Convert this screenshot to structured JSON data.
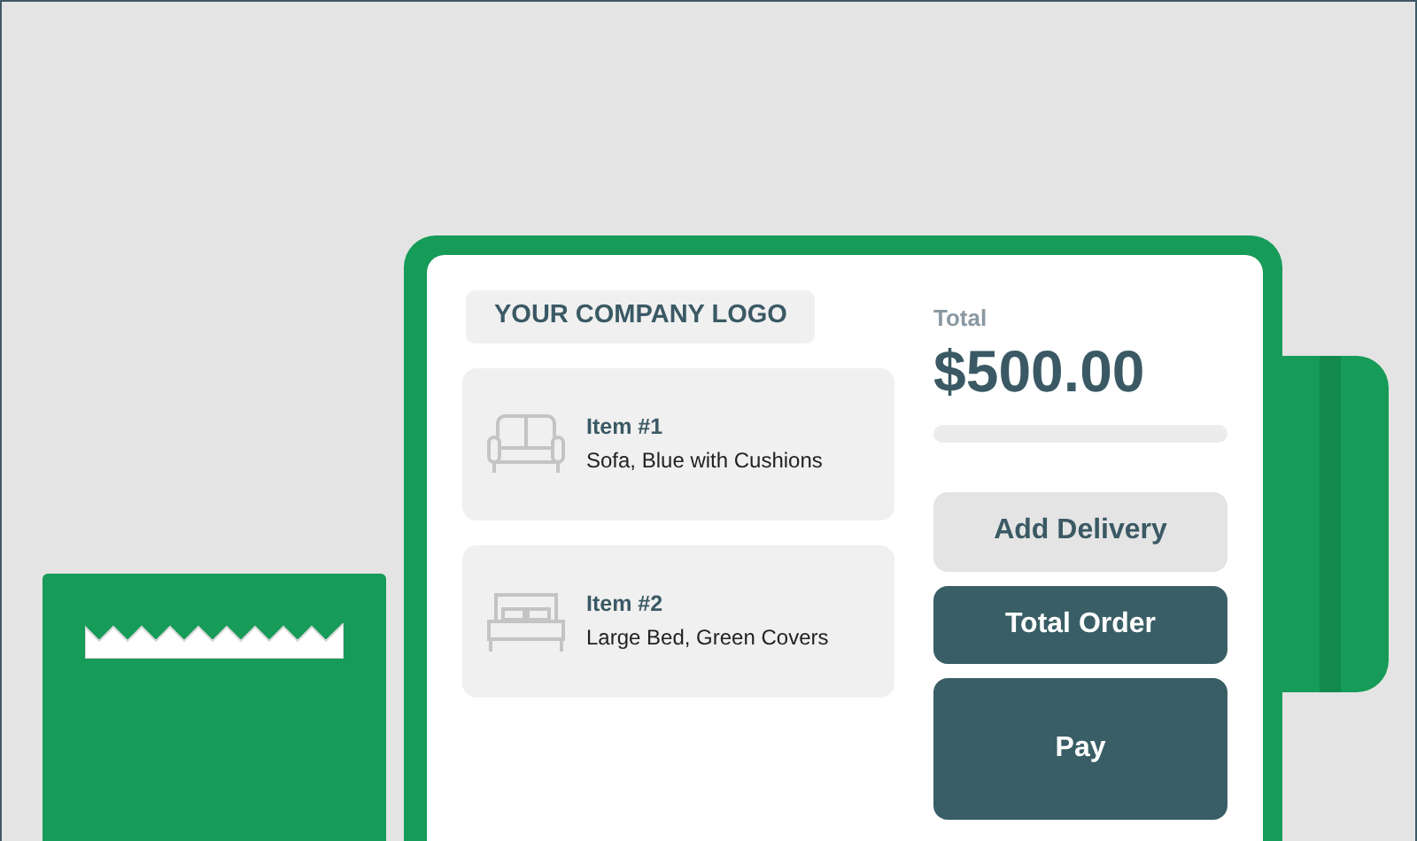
{
  "screen": {
    "logo": "YOUR COMPANY LOGO",
    "items": [
      {
        "title": "Item #1",
        "description": "Sofa, Blue with Cushions"
      },
      {
        "title": "Item #2",
        "description": "Large Bed, Green Covers"
      }
    ],
    "total_label": "Total",
    "total": "$500.00",
    "buttons": [
      {
        "label": "Add Delivery",
        "kind": "light"
      },
      {
        "label": "Total Order",
        "kind": "dark"
      },
      {
        "label": "Pay",
        "kind": "large"
      }
    ]
  }
}
